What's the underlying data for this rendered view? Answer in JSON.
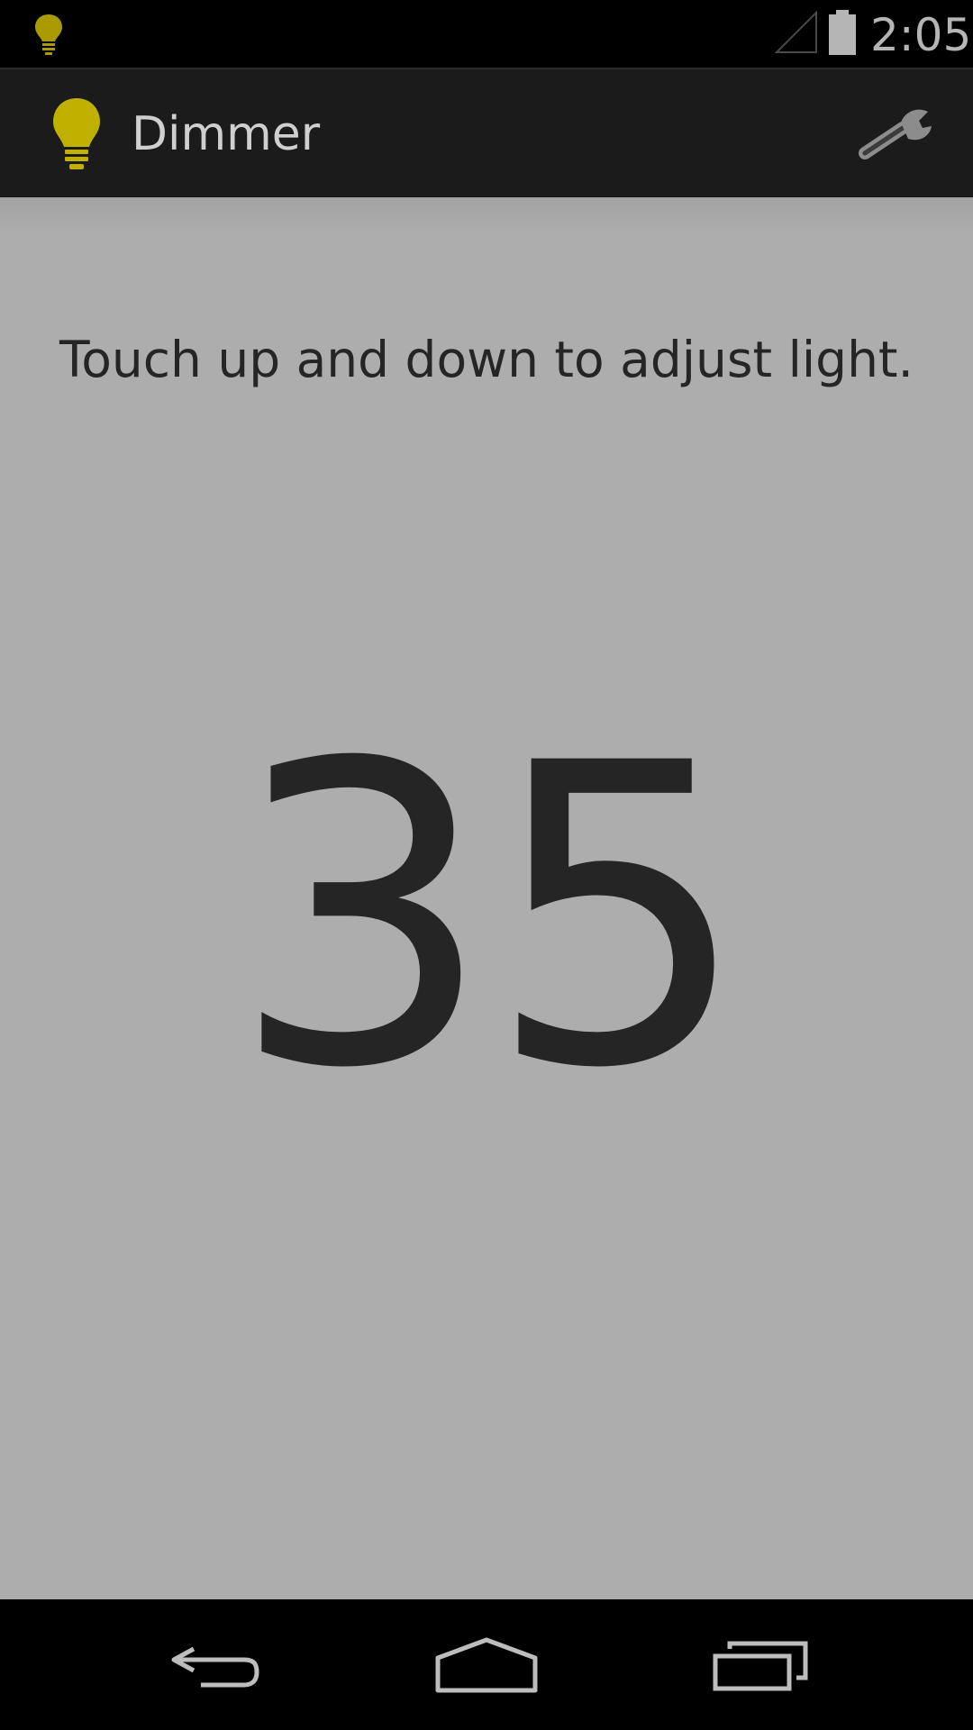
{
  "status_bar": {
    "time": "2:05",
    "notification_icon": "lightbulb-icon",
    "signal_icon": "signal-icon",
    "battery_icon": "battery-icon"
  },
  "action_bar": {
    "title": "Dimmer",
    "app_icon": "lightbulb-icon",
    "settings_icon": "wrench-icon"
  },
  "main": {
    "instruction": "Touch up and down to adjust light.",
    "level": "35"
  },
  "nav_bar": {
    "back_icon": "back-icon",
    "home_icon": "home-icon",
    "recents_icon": "recents-icon"
  },
  "colors": {
    "accent_bulb": "#b8a800",
    "content_background": "#adadad",
    "action_bar_background": "#1b1b1b",
    "text_dark": "#252525"
  }
}
